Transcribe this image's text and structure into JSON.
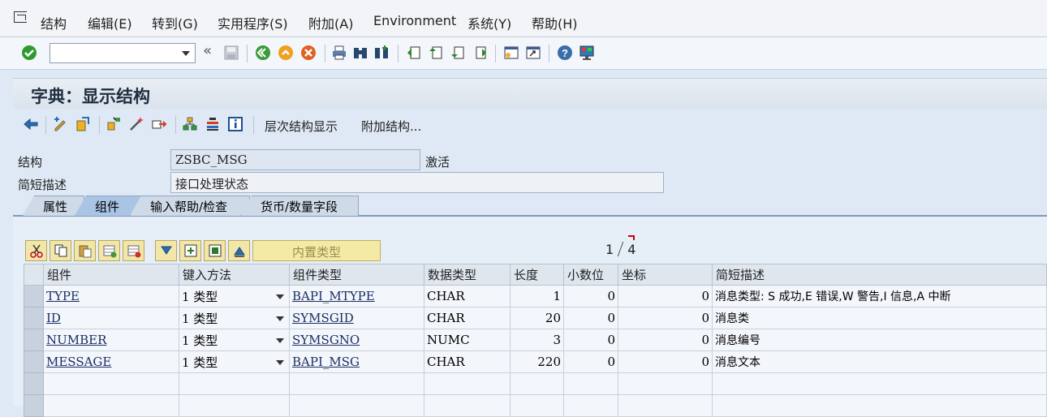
{
  "menu": {
    "items": [
      "结构",
      "编辑(E)",
      "转到(G)",
      "实用程序(S)",
      "附加(A)",
      "Environment",
      "系统(Y)",
      "帮助(H)"
    ]
  },
  "toolbar": {
    "command_value": "",
    "double_arrow": "«"
  },
  "title": "字典：显示结构",
  "app_toolbar": {
    "hierarchy_label": "层次结构显示",
    "append_label": "附加结构..."
  },
  "form": {
    "structure_label": "结构",
    "structure_value": "ZSBC_MSG",
    "status": "激活",
    "short_desc_label": "简短描述",
    "short_desc_value": "接口处理状态"
  },
  "tabs": [
    "属性",
    "组件",
    "输入帮助/检查",
    "货币/数量字段"
  ],
  "active_tab": 1,
  "grid_toolbar": {
    "builtin_type_label": "内置类型"
  },
  "pager": {
    "current": "1",
    "total": "4"
  },
  "table": {
    "headers": [
      "组件",
      "键入方法",
      "组件类型",
      "数据类型",
      "长度",
      "小数位",
      "坐标",
      "简短描述"
    ],
    "rows": [
      {
        "component": "TYPE",
        "method": "1 类型",
        "comp_type": "BAPI_MTYPE",
        "data_type": "CHAR",
        "length": "1",
        "decimals": "0",
        "coord": "0",
        "desc": "消息类型: S 成功,E 错误,W 警告,I 信息,A 中断"
      },
      {
        "component": "ID",
        "method": "1 类型",
        "comp_type": "SYMSGID",
        "data_type": "CHAR",
        "length": "20",
        "decimals": "0",
        "coord": "0",
        "desc": "消息类"
      },
      {
        "component": "NUMBER",
        "method": "1 类型",
        "comp_type": "SYMSGNO",
        "data_type": "NUMC",
        "length": "3",
        "decimals": "0",
        "coord": "0",
        "desc": "消息编号"
      },
      {
        "component": "MESSAGE",
        "method": "1 类型",
        "comp_type": "BAPI_MSG",
        "data_type": "CHAR",
        "length": "220",
        "decimals": "0",
        "coord": "0",
        "desc": "消息文本"
      }
    ]
  }
}
